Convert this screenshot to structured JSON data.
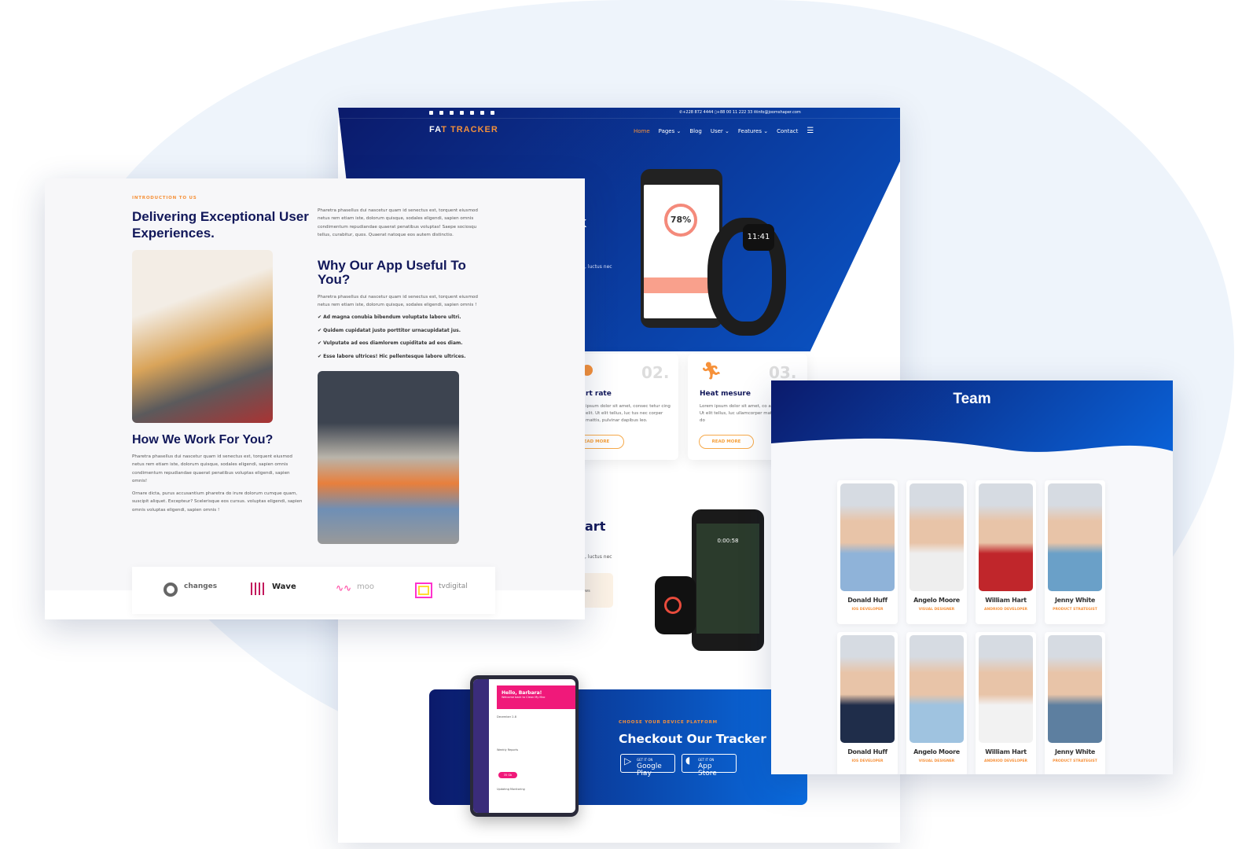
{
  "back_page": {
    "topbar": {
      "phone1": "+228 872 4444",
      "phone2": "+88 00 11 222 33",
      "email": "info@joomshaper.com"
    },
    "logo": "FAT TRACKER",
    "nav": [
      {
        "label": "Home",
        "active": true
      },
      {
        "label": "Pages ⌄"
      },
      {
        "label": "Blog"
      },
      {
        "label": "User ⌄"
      },
      {
        "label": "Features ⌄"
      },
      {
        "label": "Contact"
      }
    ],
    "hero_title_fragment": "k",
    "hero_text_fragment": ", luctus nec",
    "watch_time": "11:41",
    "phone_stat": "78%",
    "cards": [
      {
        "number": "02.",
        "title": "rt rate",
        "text": "ipsum dolor sit amet, consec tetur cing elit. Ut elit tellus, luc tus nec corper mattis, pulvinar dapibus leo.",
        "button": "EAD MORE"
      },
      {
        "number": "03.",
        "title": "Heat mesure",
        "text": "Lorem ipsum dolor sit amet, co adipiscing elit. Ut elit tellus, luc ullamcorper mattis, pulvinar do",
        "button": "READ MORE"
      }
    ],
    "section2_title_fragment": "art",
    "section2_text_fragment": ", luctus nec",
    "section2_box_fragment": "ws",
    "device_time": "0:00:58",
    "cta": {
      "eyebrow": "CHOOSE YOUR DEVICE PLATFORM",
      "title": "Checkout Our Tracker",
      "google": {
        "small": "GET IT ON",
        "label": "Google Play"
      },
      "apple": {
        "small": "GET IT ON",
        "label": "App Store"
      },
      "tablet_greeting": "Hello, Barbara!",
      "tablet_sub": "Welcome back to Clean My Mac",
      "tablet_date": "December 2-8",
      "tablet_reports": "Weekly Reports",
      "tablet_monitor": "Updating Monitoring",
      "tablet_value": "35 Gb"
    }
  },
  "front_page": {
    "eyebrow": "INTRODUCTION TO US",
    "title": "Delivering Exceptional User Experiences.",
    "intro": "Pharetra phasellus dui nascetur quam id senectus est, torquent eiusmod netus rem etiam iste, dolorum quisque, sodales eligendi, sapien omnis condimentum repudiandae quaerat penatibus voluptas! Saepe sociosqu tellus, curabitur, quos. Quaerat natoque eos autem distinctio.",
    "why_title": "Why Our App Useful To You?",
    "why_text": "Pharetra phasellus dui nascetur quam id senectus est, torquent eiusmod netus rem etiam iste, dolorum quisque, sodales eligendi, sapien omnis !",
    "checks": [
      "Ad magna conubia bibendum voluptate labore ultri.",
      "Quidem cupidatat justo porttitor urnacupidatat jus.",
      "Vulputate ad eos diamlorem cupiditate ad eos diam.",
      "Esse labore ultrices! Hic pellentesque labore ultrices."
    ],
    "how_title": "How We Work For You?",
    "how_p1": "Pharetra phasellus dui nascetur quam id senectus est, torquent eiusmod netus rem etiam iste, dolorum quisque, sodales eligendi, sapien omnis condimentum repudiandae quaerat penatibus voluptas eligendi, sapien omnis!",
    "how_p2": "Ornare dicta, purus accusantium pharetra do irure dolorum cumque quam, suscipit aliquet. Excepteur? Scelerisque eos cursus. voluptas eligendi, sapien omnis voluptas eligendi, sapien omnis !",
    "brands": [
      "changes",
      "Wave",
      "moo",
      "tvdigital"
    ]
  },
  "team_page": {
    "title": "Team",
    "members": [
      {
        "name": "Donald Huff",
        "role": "IOS DEVELOPER"
      },
      {
        "name": "Angelo Moore",
        "role": "VISUAL DESIGNER"
      },
      {
        "name": "William Hart",
        "role": "ANDRIOD DEVELOPER"
      },
      {
        "name": "Jenny White",
        "role": "PRODUCT STRATEGIST"
      },
      {
        "name": "Donald Huff",
        "role": "IOS DEVELOPER"
      },
      {
        "name": "Angelo Moore",
        "role": "VISUAL DESIGNER"
      },
      {
        "name": "William Hart",
        "role": "ANDRIOD DEVELOPER"
      },
      {
        "name": "Jenny White",
        "role": "PRODUCT STRATEGIST"
      }
    ]
  },
  "colors": {
    "navy": "#12185a",
    "accent": "#f6913a",
    "blue": "#0a56c8"
  }
}
